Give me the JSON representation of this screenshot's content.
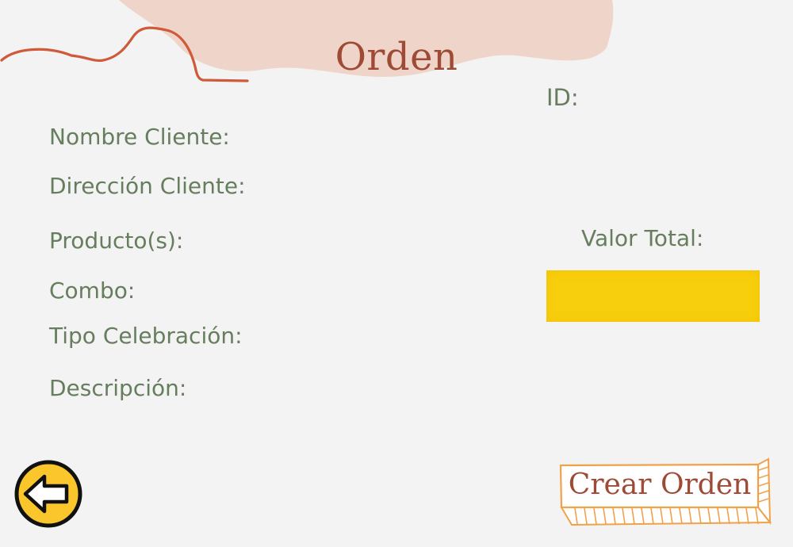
{
  "header": {
    "title": "Orden"
  },
  "form": {
    "id_label": "ID:",
    "fields": [
      {
        "label": "Nombre Cliente:"
      },
      {
        "label": "Dirección Cliente:"
      },
      {
        "label": "Producto(s):"
      },
      {
        "label": "Combo:"
      },
      {
        "label": "Tipo Celebración:"
      },
      {
        "label": "Descripción:"
      }
    ],
    "total": {
      "label": "Valor Total:",
      "value": ""
    }
  },
  "actions": {
    "back_icon": "arrow-left-icon",
    "create_label": "Crear Orden"
  },
  "colors": {
    "background": "#f3f3f3",
    "title": "#9e4a35",
    "label": "#667d5e",
    "total_box": "#f8cf0c",
    "blob": "#efd4ca",
    "accent_line": "#cf5a3a",
    "button_border": "#f0a24a",
    "back_button_fill": "#fbc62c"
  }
}
